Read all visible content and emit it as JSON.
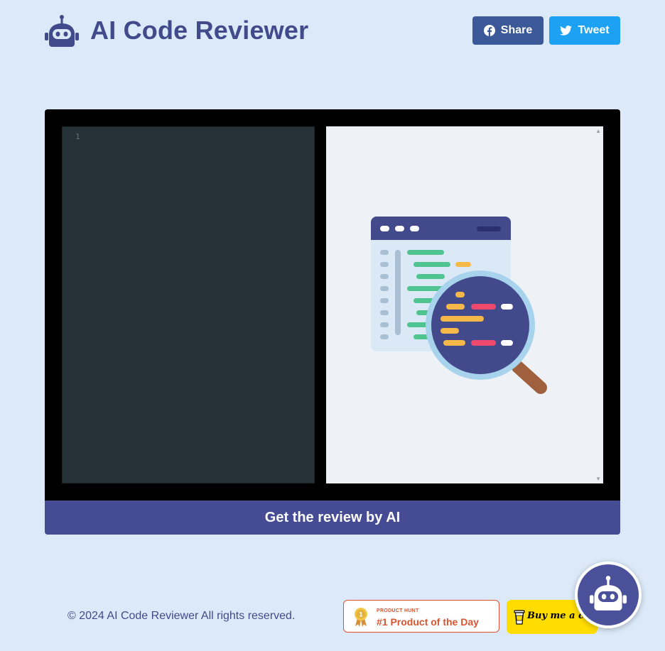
{
  "app": {
    "title": "AI Code Reviewer",
    "logo_icon": "robot-icon"
  },
  "header": {
    "share_label": "Share",
    "share_icon": "facebook-icon",
    "tweet_label": "Tweet",
    "tweet_icon": "twitter-bird-icon"
  },
  "editor": {
    "line_numbers": [
      "1"
    ],
    "content": ""
  },
  "review_panel": {
    "illustration": "code-review-magnifier-illustration"
  },
  "actions": {
    "review_label": "Get the review by AI"
  },
  "footer": {
    "copyright": "© 2024 AI Code Reviewer All rights reserved.",
    "product_hunt": {
      "kicker": "PRODUCT HUNT",
      "title": "#1 Product of the Day",
      "icon": "medal-icon"
    },
    "buy_coffee": {
      "label": "Buy me a coffee",
      "icon": "coffee-cup-icon"
    },
    "chat_icon": "robot-icon"
  },
  "colors": {
    "background": "#dbe9f8",
    "brand": "#434a8c",
    "facebook": "#3b5998",
    "twitter": "#1da1f2",
    "editor_bg": "#263238",
    "button": "#454c93",
    "product_hunt": "#da552f",
    "coffee": "#ffdd00"
  }
}
